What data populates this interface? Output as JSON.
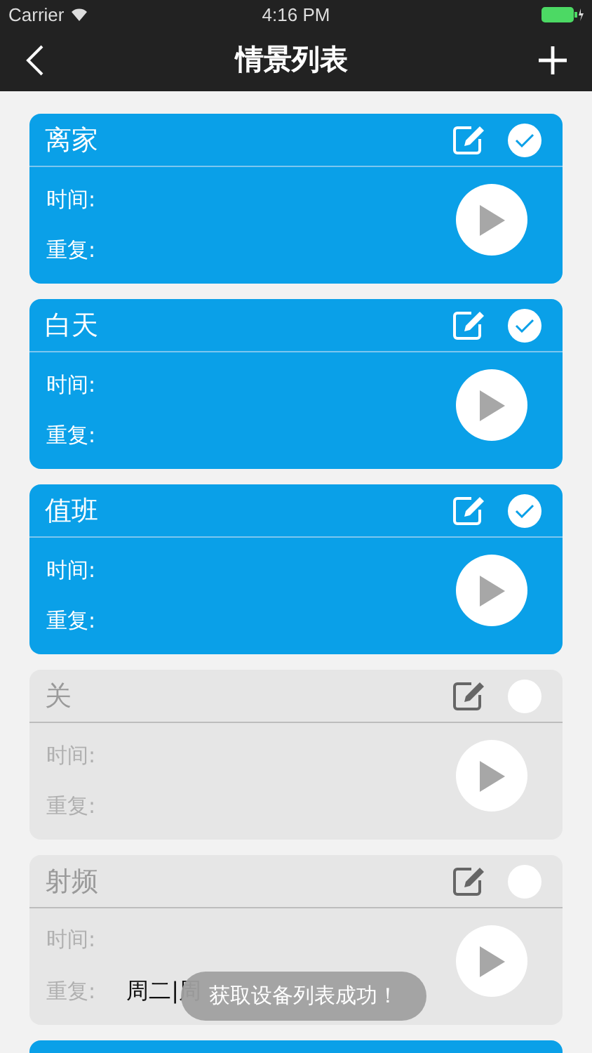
{
  "status_bar": {
    "carrier": "Carrier",
    "time": "4:16 PM"
  },
  "nav": {
    "title": "情景列表"
  },
  "scenes": [
    {
      "name": "离家",
      "active": true,
      "time_label": "时间:",
      "repeat_label": "重复:"
    },
    {
      "name": "白天",
      "active": true,
      "time_label": "时间:",
      "repeat_label": "重复:"
    },
    {
      "name": "值班",
      "active": true,
      "time_label": "时间:",
      "repeat_label": "重复:"
    },
    {
      "name": "关",
      "active": false,
      "time_label": "时间:",
      "repeat_label": "重复:"
    },
    {
      "name": "射频",
      "active": false,
      "time_label": "时间:",
      "repeat_label": "重复:",
      "repeat_value": "周二|周"
    },
    {
      "active": true
    }
  ],
  "toast": {
    "text": "获取设备列表成功！"
  }
}
